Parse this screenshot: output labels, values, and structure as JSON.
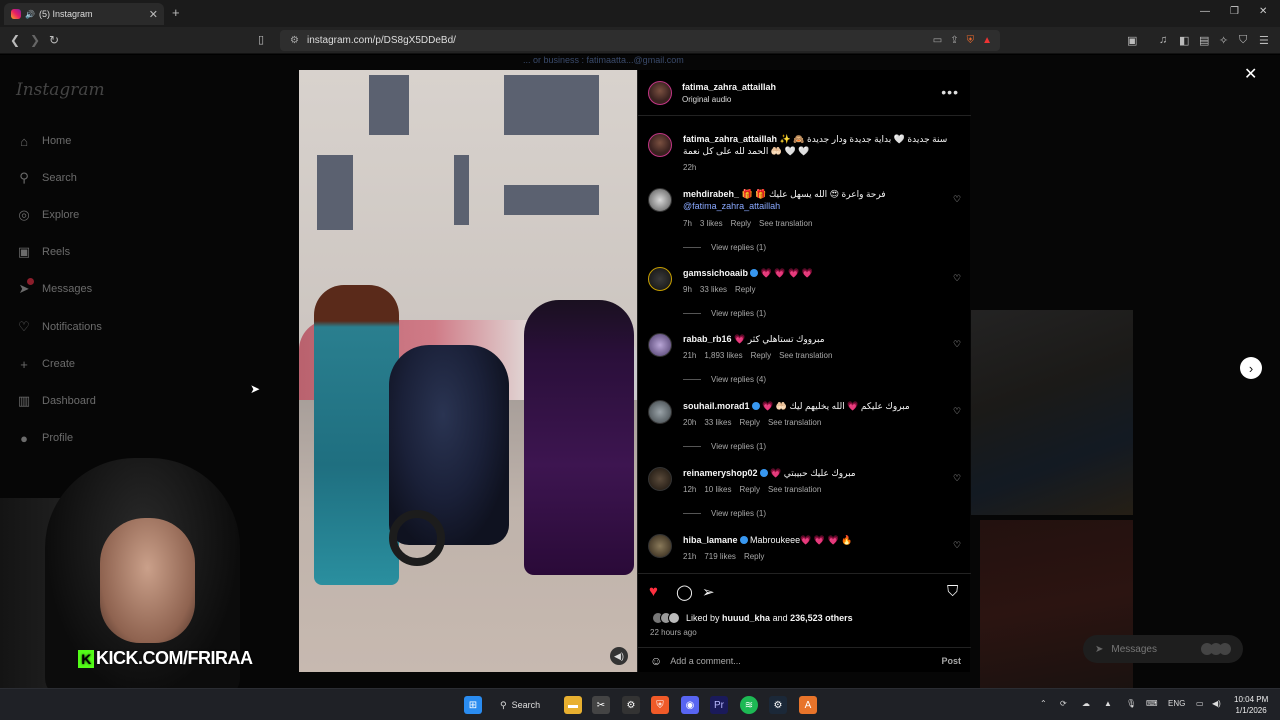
{
  "browser": {
    "tab_title": "(5) Instagram",
    "tab_speaker": "🔊",
    "new_tab": "+",
    "url": "instagram.com/p/DS8gX5DDeBd/"
  },
  "sidebar": {
    "logo": "Instagram",
    "items": [
      {
        "label": "Home"
      },
      {
        "label": "Search"
      },
      {
        "label": "Explore"
      },
      {
        "label": "Reels"
      },
      {
        "label": "Messages"
      },
      {
        "label": "Notifications"
      },
      {
        "label": "Create"
      },
      {
        "label": "Dashboard"
      },
      {
        "label": "Profile"
      }
    ]
  },
  "background_text": "... or business : fatimaatta...@gmail.com",
  "post": {
    "author": "fatima_zahra_attaillah",
    "audio": "Original audio",
    "caption_user": "fatima_zahra_attaillah",
    "caption_text": "✨ 🙈 سنة جديدة 🤍 بداية جديدة ودار جديدة الحمد لله على كل نعمة 🤲🏻 🤍 🤍",
    "caption_time": "22h",
    "comments": [
      {
        "user": "mehdirabeh_",
        "text": "🎁 🎁 فرحة واعرة 😍 الله يسهل عليك",
        "mention": "@fatima_zahra_attaillah",
        "time": "7h",
        "likes": "3 likes",
        "reply": "Reply",
        "translate": "See translation",
        "replies": "View replies (1)",
        "verified": false
      },
      {
        "user": "gamssichoaaib",
        "text": "💗 💗 💗 💗",
        "time": "9h",
        "likes": "33 likes",
        "reply": "Reply",
        "translate": "",
        "replies": "View replies (1)",
        "verified": true
      },
      {
        "user": "rabab_rb16",
        "text": "💗 مبرووك تستاهلي كثر",
        "time": "21h",
        "likes": "1,893 likes",
        "reply": "Reply",
        "translate": "See translation",
        "replies": "View replies (4)",
        "verified": false
      },
      {
        "user": "souhail.morad1",
        "text": "💗 🤲🏻 مبروك عليكم 💗 الله يخليهم ليك",
        "time": "20h",
        "likes": "33 likes",
        "reply": "Reply",
        "translate": "See translation",
        "replies": "View replies (1)",
        "verified": true
      },
      {
        "user": "reinameryshop02",
        "text": "💗 مبروك عليك حبيبتي",
        "time": "12h",
        "likes": "10 likes",
        "reply": "Reply",
        "translate": "See translation",
        "replies": "View replies (1)",
        "verified": true
      },
      {
        "user": "hiba_lamane",
        "text": "Mabroukeee💗 💗 💗 🔥",
        "time": "21h",
        "likes": "719 likes",
        "reply": "Reply",
        "translate": "",
        "replies": "",
        "verified": true
      }
    ],
    "liked_by_prefix": "Liked by",
    "liked_by_user": "huuud_kha",
    "liked_by_and": "and",
    "liked_by_count": "236,523 others",
    "posted_ago": "22 hours ago",
    "add_comment_placeholder": "Add a comment...",
    "post_button": "Post"
  },
  "messages_pill": "Messages",
  "webcam_overlay": "KICK.COM/FRIRAA",
  "taskbar": {
    "search_label": "Search",
    "lang": "ENG",
    "time": "10:04 PM",
    "date": "1/1/2026"
  },
  "colors": {
    "like_red": "#ff3040",
    "verified_blue": "#3897f0",
    "kick_green": "#53fc18"
  }
}
